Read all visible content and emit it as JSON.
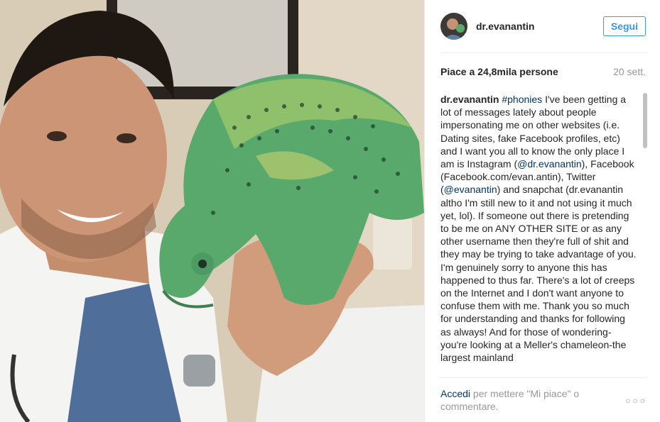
{
  "post": {
    "username": "dr.evanantin",
    "follow_label": "Segui",
    "likes": "Piace a 24,8mila persone",
    "time_ago": "20 sett.",
    "caption": {
      "user": "dr.evanantin",
      "hashtag": "#phonies",
      "part1": " I've been getting a lot of messages lately about people impersonating me on other websites (i.e. Dating sites, fake Facebook profiles, etc) and I want you all to know the only place I am is Instagram (",
      "mention1": "@dr.evanantin",
      "part2": "), Facebook (Facebook.com/evan.antin), Twitter (",
      "mention2": "@evanantin",
      "part3": ") and snapchat (dr.evanantin altho I'm still new to it and not using it much yet, lol). If someone out there is pretending to be me on ANY OTHER SITE or as any other username then they're full of shit and they may be trying to take advantage of you. I'm genuinely sorry to anyone this has happened to thus far. There's a lot of creeps on the Internet and I don't want anyone to confuse them with me. Thank you so much for understanding and thanks for following as always! And for those of wondering-you're looking at a Meller's chameleon-the largest mainland"
    },
    "footer": {
      "login_link": "Accedi",
      "login_text": " per mettere \"Mi piace\" o commentare."
    },
    "more_label": "○○○"
  }
}
